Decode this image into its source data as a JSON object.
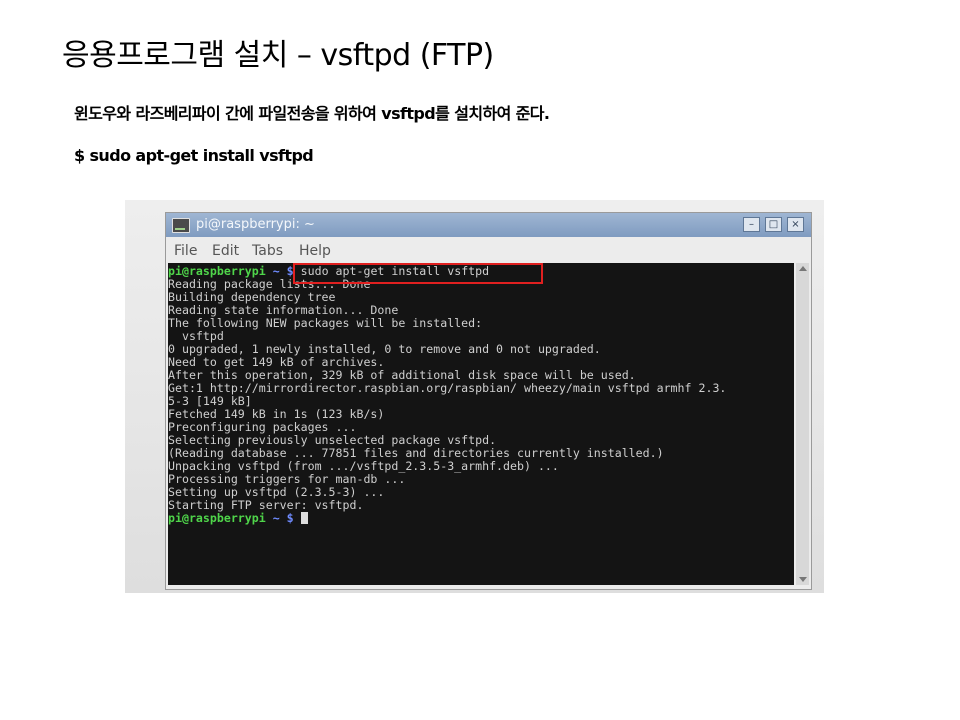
{
  "slide": {
    "title": "응용프로그램 설치 – vsftpd (FTP)",
    "description": "윈도우와 라즈베리파이 간에 파일전송을 위하여 vsftpd를 설치하여 준다.",
    "command": "$ sudo apt-get install vsftpd"
  },
  "window": {
    "title": "pi@raspberrypi: ~",
    "buttons": {
      "minimize": "–",
      "maximize": "□",
      "close": "×"
    },
    "menu": [
      "File",
      "Edit",
      "Tabs",
      "Help"
    ]
  },
  "terminal": {
    "prompt_user": "pi@raspberrypi",
    "prompt_path": "~ $",
    "first_command": " sudo apt-get install vsftpd",
    "output": [
      "Reading package lists... Done",
      "Building dependency tree",
      "Reading state information... Done",
      "The following NEW packages will be installed:",
      "  vsftpd",
      "0 upgraded, 1 newly installed, 0 to remove and 0 not upgraded.",
      "Need to get 149 kB of archives.",
      "After this operation, 329 kB of additional disk space will be used.",
      "Get:1 http://mirrordirector.raspbian.org/raspbian/ wheezy/main vsftpd armhf 2.3.",
      "5-3 [149 kB]",
      "Fetched 149 kB in 1s (123 kB/s)",
      "Preconfiguring packages ...",
      "Selecting previously unselected package vsftpd.",
      "(Reading database ... 77851 files and directories currently installed.)",
      "Unpacking vsftpd (from .../vsftpd_2.3.5-3_armhf.deb) ...",
      "Processing triggers for man-db ...",
      "Setting up vsftpd (2.3.5-3) ...",
      "Starting FTP server: vsftpd."
    ]
  },
  "colors": {
    "highlight_box": "#e02020",
    "prompt_user": "#4fd54a",
    "prompt_path": "#6f8bff",
    "terminal_bg": "#141414"
  }
}
